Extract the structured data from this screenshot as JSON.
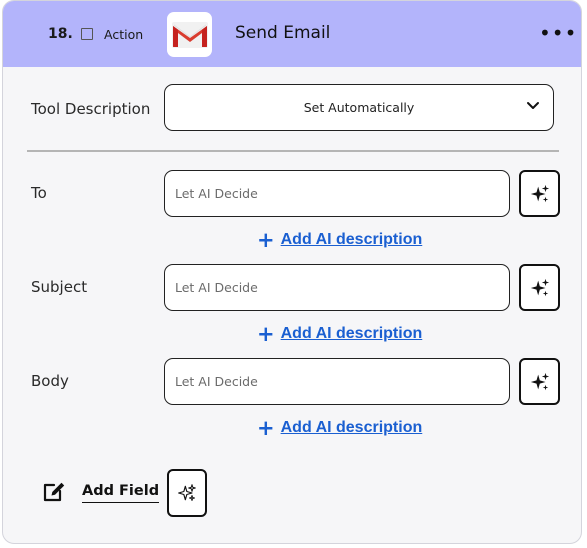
{
  "header": {
    "step_number": "18.",
    "action_label": "Action",
    "app_title": "Send Email",
    "app_icon": "gmail-icon",
    "more_icon": "more-horizontal-icon",
    "background_color": "#b3b4fb"
  },
  "tool_description": {
    "label": "Tool Description",
    "value": "Set Automatically",
    "dropdown_icon": "chevron-down-icon"
  },
  "fields": [
    {
      "label": "To",
      "placeholder": "Let AI Decide",
      "ai_icon": "sparkles-icon",
      "add_description": "Add AI description"
    },
    {
      "label": "Subject",
      "placeholder": "Let AI Decide",
      "ai_icon": "sparkles-icon",
      "add_description": "Add AI description"
    },
    {
      "label": "Body",
      "placeholder": "Let AI Decide",
      "ai_icon": "sparkles-icon",
      "add_description": "Add AI description"
    }
  ],
  "footer": {
    "edit_icon": "edit-icon",
    "add_field_label": "Add Field",
    "ai_icon": "sparkles-icon"
  },
  "colors": {
    "link": "#1a5fd1",
    "card_background": "#f6f6f8"
  }
}
